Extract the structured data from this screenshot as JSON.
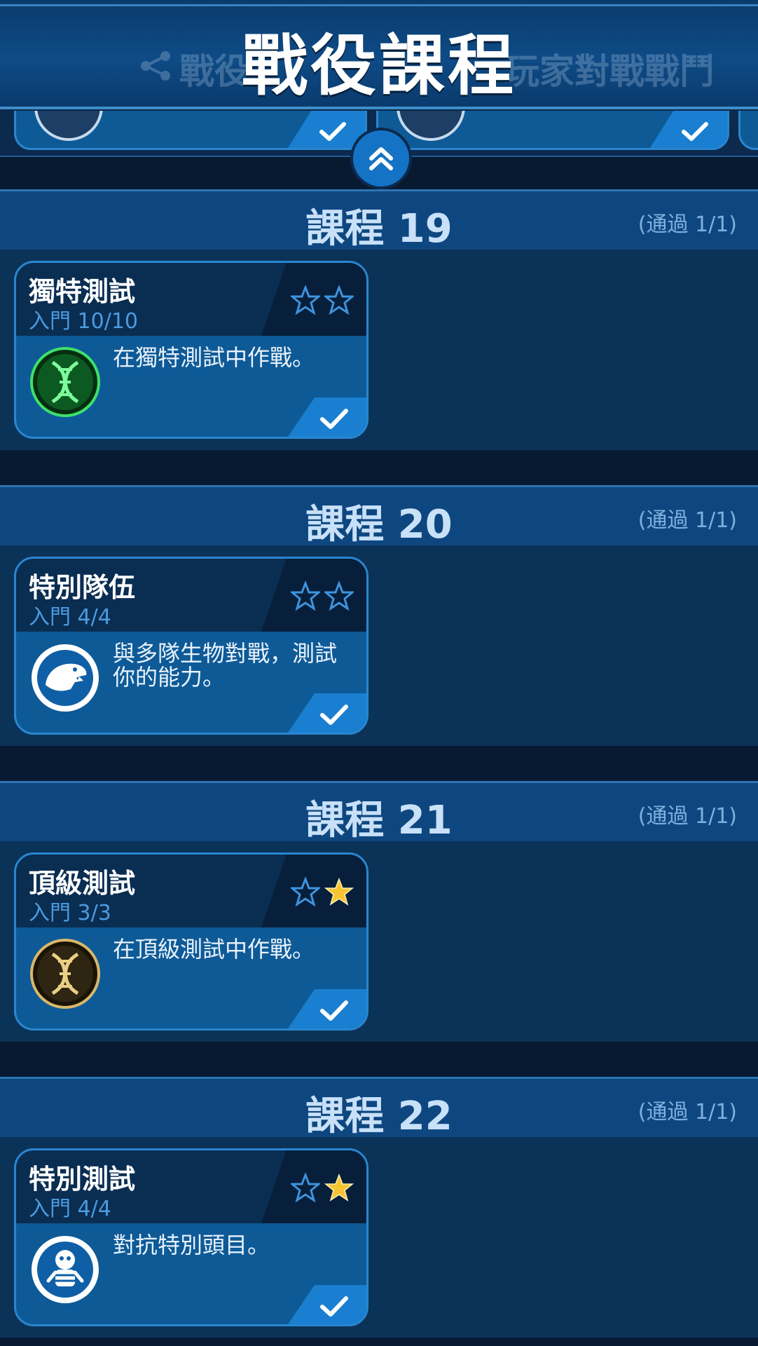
{
  "header": {
    "title": "戰役課程",
    "ghost_tabs": [
      "戰役",
      "玩家對戰戰鬥"
    ]
  },
  "sections": [
    {
      "title": "課程 19",
      "status": "(通過 1/1)",
      "card": {
        "name": "獨特測試",
        "progress": "入門 10/10",
        "description": "在獨特測試中作戰。",
        "icon": "green-dna-icon",
        "stars_filled": 0,
        "stars_total": 2,
        "completed": true
      }
    },
    {
      "title": "課程 20",
      "status": "(通過 1/1)",
      "card": {
        "name": "特別隊伍",
        "progress": "入門 4/4",
        "description": "與多隊生物對戰，測試你的能力。",
        "icon": "trex-logo-icon",
        "stars_filled": 0,
        "stars_total": 2,
        "completed": true
      }
    },
    {
      "title": "課程 21",
      "status": "(通過 1/1)",
      "card": {
        "name": "頂級測試",
        "progress": "入門 3/3",
        "description": "在頂級測試中作戰。",
        "icon": "gold-dna-icon",
        "stars_filled": 1,
        "stars_total": 2,
        "completed": true
      }
    },
    {
      "title": "課程 22",
      "status": "(通過 1/1)",
      "card": {
        "name": "特別測試",
        "progress": "入門 4/4",
        "description": "對抗特別頭目。",
        "icon": "boss-character-icon",
        "stars_filled": 1,
        "stars_total": 2,
        "completed": true
      }
    }
  ],
  "colors": {
    "header": "#0e4b86",
    "section_head": "#0e4780",
    "card": "#0e5a97",
    "accent": "#1a7fd0",
    "star_gold": "#f7c531",
    "progress_text": "#4b9be0"
  }
}
